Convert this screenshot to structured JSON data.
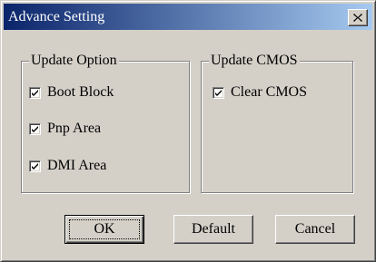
{
  "window": {
    "title": "Advance Setting",
    "titlebar_colors": [
      "#0a246a",
      "#a6caf0"
    ],
    "close_icon": "close-icon"
  },
  "update_option": {
    "legend": "Update Option",
    "items": [
      {
        "label": "Boot Block",
        "checked": true
      },
      {
        "label": "Pnp Area",
        "checked": true
      },
      {
        "label": "DMI Area",
        "checked": true
      }
    ]
  },
  "update_cmos": {
    "legend": "Update CMOS",
    "items": [
      {
        "label": "Clear CMOS",
        "checked": true
      }
    ]
  },
  "buttons": {
    "ok": "OK",
    "default": "Default",
    "cancel": "Cancel"
  }
}
